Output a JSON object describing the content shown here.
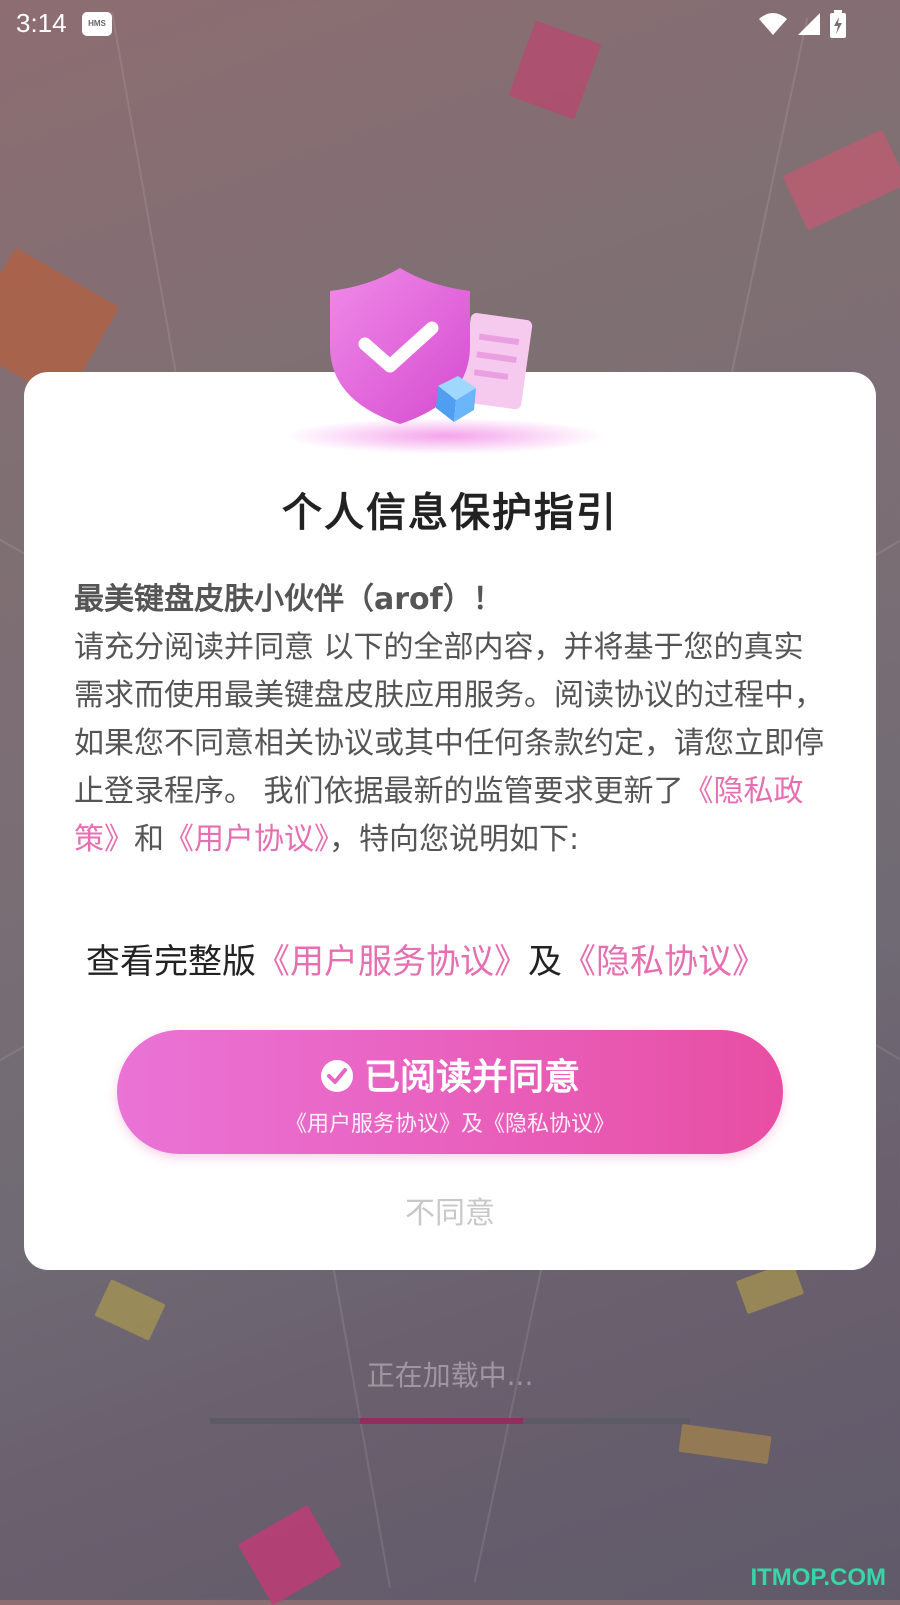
{
  "status_bar": {
    "time": "3:14",
    "hms_badge": "HMS",
    "icons": [
      "wifi-icon",
      "signal-icon",
      "battery-charging-icon"
    ]
  },
  "dialog": {
    "title": "个人信息保护指引",
    "greeting": "最美键盘皮肤小伙伴（arof）！",
    "paragraph_1": "请充分阅读并同意 以下的全部内容，并将基于您的真实需求而使用最美键盘皮肤应用服务。阅读协议的过程中，如果您不同意相关协议或其中任何条款约定，请您立即停止登录程序。 我们依据最新的监管要求更新了",
    "privacy_policy_link": "《隐私政策》",
    "and_text": "和",
    "user_agreement_link": "《用户协议》",
    "paragraph_2": "，特向您说明如下:",
    "view_full_prefix": "查看完整版",
    "user_service_link": "《用户服务协议》",
    "and_text_2": "及",
    "privacy_agreement_link": "《隐私协议》",
    "agree_button": {
      "label": "已阅读并同意",
      "sublabel": "《用户服务协议》及《隐私协议》"
    },
    "disagree_button": "不同意"
  },
  "loading": {
    "text": "正在加载中...",
    "progress": 0.65
  },
  "watermark": "ITMOP.COM",
  "colors": {
    "accent_pink": "#e66fb1",
    "button_gradient_start": "#ea73d6",
    "button_gradient_end": "#e84ea3",
    "progress_fill": "#8e2f60"
  }
}
